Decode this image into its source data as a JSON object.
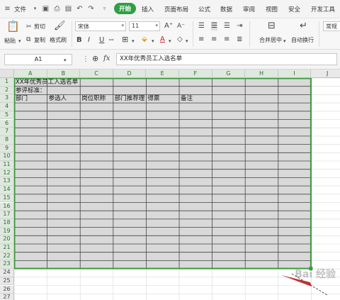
{
  "menu": {
    "file": "文件",
    "tabs": [
      "开始",
      "插入",
      "页面布局",
      "公式",
      "数据",
      "审阅",
      "视图",
      "安全",
      "开发工具"
    ],
    "active_tab": "开始"
  },
  "toolbar": {
    "cut": "剪切",
    "paste": "粘贴",
    "copy": "复制",
    "format_painter": "格式刷",
    "font_name": "宋体",
    "font_size": "11",
    "bold": "B",
    "italic": "I",
    "underline": "U",
    "grow_font": "A⁺",
    "shrink_font": "A⁻",
    "merge_center": "合并居中",
    "wrap_text": "自动换行",
    "number_format": "常规"
  },
  "formula_bar": {
    "cell_ref": "A1",
    "fx": "fx",
    "content": "XX年优秀员工入选名单"
  },
  "sheet": {
    "columns": [
      "A",
      "B",
      "C",
      "D",
      "E",
      "F",
      "G",
      "H",
      "I",
      "J"
    ],
    "rows": [
      "1",
      "2",
      "3",
      "4",
      "5",
      "6",
      "7",
      "8",
      "9",
      "10",
      "11",
      "12",
      "13",
      "14",
      "15",
      "16",
      "17",
      "18",
      "19",
      "20",
      "21",
      "22",
      "23",
      "24",
      "25",
      "26",
      "27"
    ],
    "cells": {
      "A1": "XX年优秀员工入选名单",
      "A2": "参评标准：",
      "A3": "部门",
      "B3": "参选人",
      "C3": "岗位职称",
      "D3": "部门推荐理由",
      "E3": "得票",
      "F3": "备注"
    },
    "selection_color": "#3c9a3c",
    "selection_fill": "#d9d9d9"
  },
  "watermark": "Bai 经验"
}
